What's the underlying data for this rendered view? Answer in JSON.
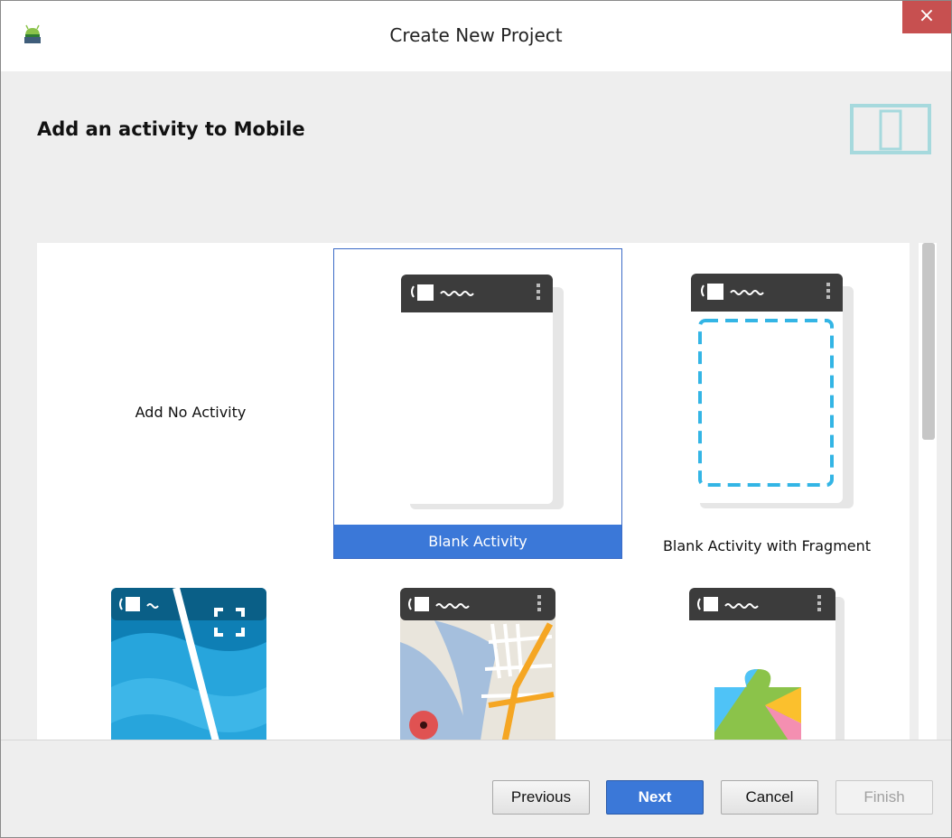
{
  "window": {
    "title": "Create New Project",
    "close_label": "×"
  },
  "header": {
    "title": "Add an activity to Mobile"
  },
  "gallery": {
    "items": [
      {
        "label": "Add No Activity"
      },
      {
        "label": "Blank Activity"
      },
      {
        "label": "Blank Activity with Fragment"
      },
      {
        "label": ""
      },
      {
        "label": ""
      },
      {
        "label": ""
      }
    ]
  },
  "footer": {
    "previous_label": "Previous",
    "next_label": "Next",
    "cancel_label": "Cancel",
    "finish_label": "Finish"
  },
  "colors": {
    "accent": "#3b78d8",
    "close": "#c75050",
    "fragment_dash": "#33b5e5",
    "phone_bar": "#3c3c3c"
  }
}
